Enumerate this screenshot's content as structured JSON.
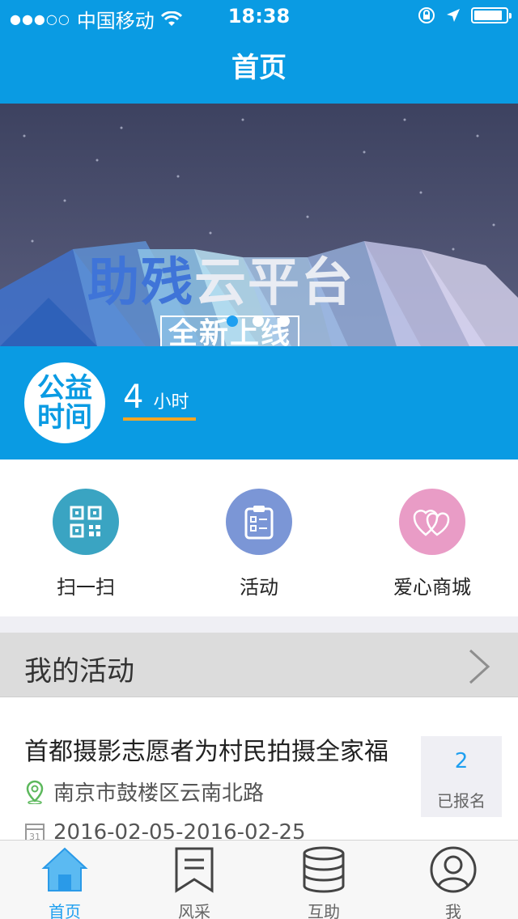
{
  "status_bar": {
    "signal": "●●●○○",
    "carrier": "中国移动",
    "time": "18:38",
    "battery_level": 0.9
  },
  "nav": {
    "title": "首页"
  },
  "banner": {
    "title_part1": "助残",
    "title_part2": "云平台",
    "subtitle": "全新上线",
    "dots": 3,
    "active_dot": 0
  },
  "welfare": {
    "logo_line1": "公益",
    "logo_line2": "时间",
    "hours": "4",
    "unit": "小时"
  },
  "actions": [
    {
      "label": "扫一扫",
      "icon": "qr-code-icon",
      "color": "#3aa4c2"
    },
    {
      "label": "活动",
      "icon": "clipboard-icon",
      "color": "#7b96d6"
    },
    {
      "label": "爱心商城",
      "icon": "hearts-icon",
      "color": "#e99cc6"
    }
  ],
  "my_activities": {
    "title": "我的活动",
    "items": [
      {
        "title": "首都摄影志愿者为村民拍摄全家福",
        "location": "南京市鼓楼区云南北路",
        "date": "2016-02-05-2016-02-25",
        "signup_count": "2",
        "signup_label": "已报名"
      }
    ]
  },
  "tabs": [
    {
      "label": "首页",
      "icon": "home-icon",
      "active": true
    },
    {
      "label": "风采",
      "icon": "bookmark-icon",
      "active": false
    },
    {
      "label": "互助",
      "icon": "database-icon",
      "active": false
    },
    {
      "label": "我",
      "icon": "user-icon",
      "active": false
    }
  ],
  "colors": {
    "primary": "#0a9be3",
    "accent": "#1e9ff0",
    "underline": "#f6a623"
  }
}
